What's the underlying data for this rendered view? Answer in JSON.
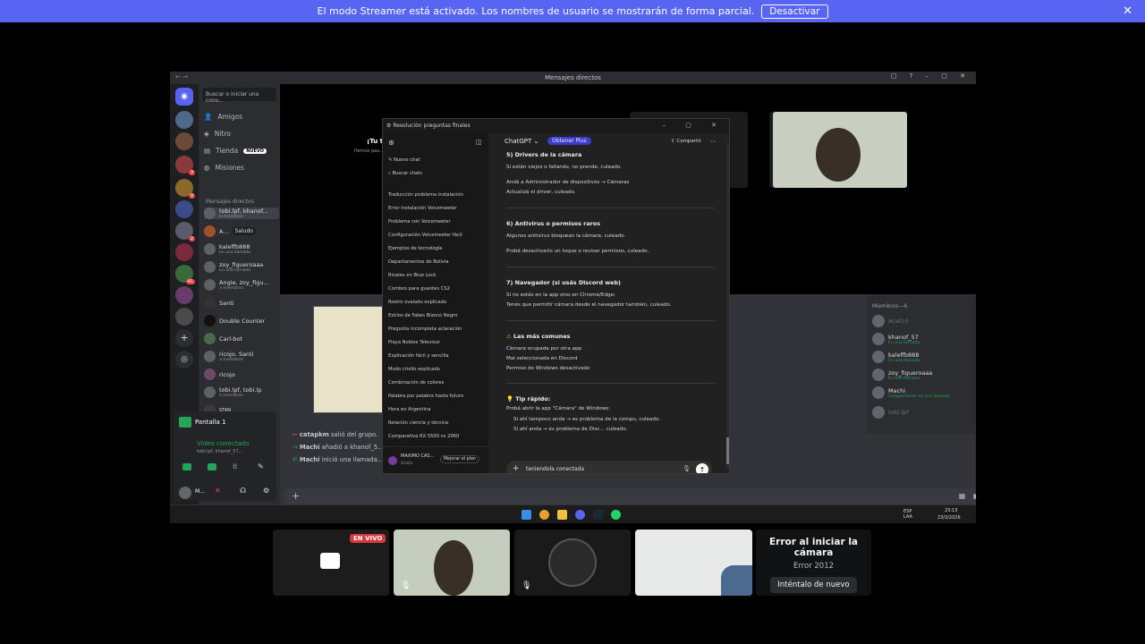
{
  "banner": {
    "message": "El modo Streamer está activado. Los nombres de usuario se mostrarán de forma parcial.",
    "button": "Desactivar"
  },
  "discord": {
    "window_title": "Mensajes directos",
    "search_placeholder": "Buscar o iniciar una conv...",
    "nav": {
      "friends": "Amigos",
      "nitro": "Nitro",
      "shop": "Tienda",
      "shop_badge": "NUEVO",
      "missions": "Misiones"
    },
    "dm_header": "Mensajes directos",
    "dms": [
      {
        "name": "tobi.lpf, khanof...",
        "sub": "6 miembros"
      },
      {
        "name": "A...",
        "sub": "",
        "extra": "Saludo"
      },
      {
        "name": "kaleffb888",
        "sub": "En una llamada"
      },
      {
        "name": "zoy_figueroaaa",
        "sub": "En una llamada"
      },
      {
        "name": "Angie, zoy_figu...",
        "sub": "3 miembros"
      },
      {
        "name": "Santi",
        "sub": ""
      },
      {
        "name": "Double Counter",
        "sub": ""
      },
      {
        "name": "Carl-bot",
        "sub": ""
      },
      {
        "name": "ricojo, Santi",
        "sub": "3 miembros"
      },
      {
        "name": "ricojo",
        "sub": ""
      },
      {
        "name": "tobi.lpf, tobi.lp",
        "sub": "4 miembros"
      },
      {
        "name": "STAN",
        "sub": ""
      }
    ],
    "voice_panel": {
      "screen_label": "Pantalla 1",
      "status": "Vídeo conectado",
      "channel": "tobi.lpf, khanof_57...",
      "user": "M..."
    },
    "call_text": {
      "title": "¡Tu t...",
      "sub": "Hemos pau..."
    },
    "chat_lines": [
      {
        "who": "catapkm",
        "text": "salió del grupo."
      },
      {
        "who": "Machi",
        "text": "añadió a khanof_5..."
      },
      {
        "who": "Machi",
        "text": "inició una llamada..."
      }
    ],
    "members_header": "Miembros—6",
    "members": [
      {
        "name": "AcaO.0",
        "sub": ""
      },
      {
        "name": "khanof_57",
        "sub": "En una llamada"
      },
      {
        "name": "kaleffb888",
        "sub": "En una llamada"
      },
      {
        "name": "zoy_figueroaaa",
        "sub": "En una llamada"
      },
      {
        "name": "Machi",
        "sub": "Compartiendo en una llamada"
      },
      {
        "name": "tobi.lpf",
        "sub": ""
      }
    ]
  },
  "chatgpt": {
    "window_title": "Resolución preguntas finales",
    "new_chat": "Nuevo chat",
    "search_chats": "Buscar chats",
    "history": [
      "Traducción problema instalación",
      "Error instalación Voicemeeter",
      "Problema con Voicemeeter",
      "Configuración Voicemeeter fácil",
      "Ejemplos de tecnología",
      "Departamentos de Bolivia",
      "Rivales en Blue Lock",
      "Combos para guantes CS2",
      "Rostro ovalado explicado",
      "Estilos de Fakes Blanco Negro",
      "Pregunta incompleta aclaración",
      "Playa Noblex Televisor",
      "Explicación fácil y sencilla",
      "Modo criollo explicado",
      "Combinación de colores",
      "Palabra por palabra hasta futuro",
      "Hora en Argentina",
      "Relación ciencia y técnica",
      "Comparativa RX 5500 vs 2060"
    ],
    "account": {
      "name": "MAXIMO CAS...",
      "plan": "Gratis",
      "upgrade": "Mejorar el plan"
    },
    "model": "ChatGPT",
    "plus": "Obtener Plus",
    "share": "Compartir",
    "content": {
      "s5_title": "5) Drivers de la cámara",
      "s5_l1": "Si están viejos o fallando, no prende, culeado.",
      "s5_l2": "Andá a Administrador de dispositivos → Cámaras",
      "s5_l3": "Actualizá el driver, culeado.",
      "s6_title": "6) Antivirus o permisos raros",
      "s6_l1": "Algunos antivirus bloquean la cámara, culeado.",
      "s6_l2": "Probá desactivarlo un toque o revisar permisos, culeado.",
      "s7_title": "7) Navegador (si usás Discord web)",
      "s7_l1": "Si no estás en la app sino en Chrome/Edge:",
      "s7_l2": "Tenés que permitir cámara desde el navegador también, culeado.",
      "common_title": "Las más comunes",
      "common_1": "Cámara ocupada por otra app",
      "common_2": "Mal seleccionada en Discord",
      "common_3": "Permiso de Windows desactivado",
      "tip_title": "Tip rápido:",
      "tip_l1": "Probá abrir la app \"Cámara\" de Windows:",
      "tip_l2": "Si ahí tampoco anda → es problema de la compu, culeado.",
      "tip_l3": "Si ahí anda → es problema de Disc... culeado."
    },
    "composer_text": "teniendola conectada"
  },
  "taskbar": {
    "lang": "ESP LAA",
    "time": "23:13",
    "date": "23/3/2026"
  },
  "bottom": {
    "live": "EN VIVO",
    "live_small": "EN VIVO",
    "error_title": "Error al iniciar la cámara",
    "error_code": "Error 2012",
    "retry": "Inténtalo de nuevo"
  }
}
